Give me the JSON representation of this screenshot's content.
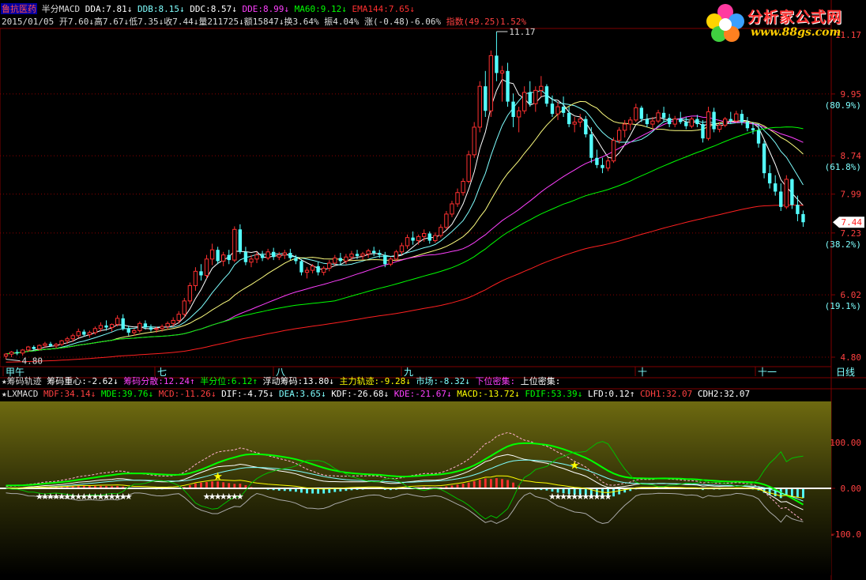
{
  "header": {
    "line1": [
      {
        "t": "鲁抗医药",
        "c": "#ff5050",
        "bg": "#0000a0"
      },
      {
        "t": " 半分MACD ",
        "c": "#dddddd"
      },
      {
        "t": "DDA:7.81↓",
        "c": "#ffffff"
      },
      {
        "t": " DDB:8.15↓",
        "c": "#7fffff"
      },
      {
        "t": " DDC:8.57↓",
        "c": "#ffffff"
      },
      {
        "t": " DDE:8.99↓",
        "c": "#ff40ff"
      },
      {
        "t": " MA60:9.12↓",
        "c": "#00ff00"
      },
      {
        "t": " EMA144:7.65↓",
        "c": "#ff3030"
      }
    ],
    "line2": [
      {
        "t": "2015/01/05 ",
        "c": "#dddddd"
      },
      {
        "t": "开7.60↓",
        "c": "#dddddd"
      },
      {
        "t": "高7.67↓",
        "c": "#dddddd"
      },
      {
        "t": "低7.35↓",
        "c": "#dddddd"
      },
      {
        "t": "收7.44↓",
        "c": "#dddddd"
      },
      {
        "t": "量211725↓",
        "c": "#dddddd"
      },
      {
        "t": "额15847↓",
        "c": "#dddddd"
      },
      {
        "t": "换3.64%",
        "c": "#dddddd"
      },
      {
        "t": " 振4.04%",
        "c": "#dddddd"
      },
      {
        "t": " 涨(-0.48)-6.06%",
        "c": "#dddddd"
      },
      {
        "t": " 指数(49.25)1.52%",
        "c": "#ff4040"
      }
    ]
  },
  "mid_header": [
    {
      "t": "★筹码轨迹 ",
      "c": "#dddddd"
    },
    {
      "t": "筹码重心:-2.62↓",
      "c": "#ffffff"
    },
    {
      "t": " 筹码分散:12.24↑",
      "c": "#ff40ff"
    },
    {
      "t": " 半分位:6.12↑",
      "c": "#00ff00"
    },
    {
      "t": " 浮动筹码:13.80↓",
      "c": "#ffffff"
    },
    {
      "t": " 主力轨迹:-9.28↓",
      "c": "#ffff00"
    },
    {
      "t": " 市场:-8.32↓",
      "c": "#7fffff"
    },
    {
      "t": " 下位密集:",
      "c": "#ff40ff"
    },
    {
      "t": " 上位密集:",
      "c": "#ffffff"
    }
  ],
  "lower_header": [
    {
      "t": "★LXMACD ",
      "c": "#dddddd"
    },
    {
      "t": "MDF:34.14↓",
      "c": "#ff4040"
    },
    {
      "t": " MDE:39.76↓",
      "c": "#00ff00"
    },
    {
      "t": " MCD:-11.26↓",
      "c": "#ff4040"
    },
    {
      "t": " DIF:-4.75↓",
      "c": "#ffffff"
    },
    {
      "t": " DEA:3.65↓",
      "c": "#7fffff"
    },
    {
      "t": " KDF:-26.68↓",
      "c": "#ffffff"
    },
    {
      "t": " KDE:-21.67↓",
      "c": "#ff40ff"
    },
    {
      "t": " MACD:-13.72↓",
      "c": "#ffff00"
    },
    {
      "t": " FDIF:53.39↓",
      "c": "#00ff00"
    },
    {
      "t": " LFD:0.12↑",
      "c": "#ffffff"
    },
    {
      "t": " CDH1:32.07",
      "c": "#ff4040"
    },
    {
      "t": " CDH2:32.07",
      "c": "#ffffff"
    }
  ],
  "price_axis": {
    "ticks": [
      {
        "v": "9.95",
        "pct": "(80.9%)"
      },
      {
        "v": "8.74",
        "pct": "(61.8%)"
      },
      {
        "v": "7.99",
        "pct": ""
      },
      {
        "v": "7.23",
        "pct": "(38.2%)"
      },
      {
        "v": "6.02",
        "pct": "(19.1%)"
      },
      {
        "v": "4.80",
        "pct": ""
      }
    ],
    "last_price": "7.44",
    "high_label": "11.17",
    "low_label": "4.80",
    "top_value": "11.17"
  },
  "macd_axis": [
    "100.00",
    "0.00",
    "-100.0"
  ],
  "months": [
    "甲午",
    "七",
    "八",
    "九",
    "十",
    "十一"
  ],
  "period_button": "日线",
  "chart_data": {
    "type": "candlestick",
    "date_last": "2015/01/05",
    "candles": [
      [
        4.82,
        4.88,
        4.76,
        4.86
      ],
      [
        4.86,
        4.92,
        4.8,
        4.9
      ],
      [
        4.9,
        4.95,
        4.84,
        4.88
      ],
      [
        4.88,
        4.96,
        4.83,
        4.94
      ],
      [
        4.94,
        5.02,
        4.9,
        5.0
      ],
      [
        5.0,
        5.03,
        4.92,
        4.96
      ],
      [
        4.96,
        5.05,
        4.93,
        5.03
      ],
      [
        5.03,
        5.1,
        4.98,
        5.06
      ],
      [
        5.06,
        5.1,
        5.0,
        5.02
      ],
      [
        5.02,
        5.08,
        4.97,
        5.05
      ],
      [
        5.05,
        5.14,
        5.02,
        5.12
      ],
      [
        5.12,
        5.2,
        5.06,
        5.16
      ],
      [
        5.16,
        5.26,
        5.1,
        5.22
      ],
      [
        5.22,
        5.36,
        5.18,
        5.3
      ],
      [
        5.3,
        5.34,
        5.2,
        5.24
      ],
      [
        5.24,
        5.32,
        5.18,
        5.28
      ],
      [
        5.28,
        5.4,
        5.24,
        5.36
      ],
      [
        5.36,
        5.48,
        5.3,
        5.42
      ],
      [
        5.42,
        5.52,
        5.32,
        5.38
      ],
      [
        5.38,
        5.46,
        5.3,
        5.44
      ],
      [
        5.44,
        5.62,
        5.4,
        5.56
      ],
      [
        5.56,
        5.64,
        5.32,
        5.36
      ],
      [
        5.36,
        5.42,
        5.22,
        5.28
      ],
      [
        5.28,
        5.36,
        5.22,
        5.32
      ],
      [
        5.32,
        5.5,
        5.28,
        5.46
      ],
      [
        5.46,
        5.52,
        5.34,
        5.38
      ],
      [
        5.38,
        5.44,
        5.3,
        5.34
      ],
      [
        5.34,
        5.4,
        5.28,
        5.36
      ],
      [
        5.36,
        5.44,
        5.3,
        5.4
      ],
      [
        5.4,
        5.5,
        5.34,
        5.46
      ],
      [
        5.46,
        5.58,
        5.4,
        5.52
      ],
      [
        5.52,
        5.7,
        5.46,
        5.64
      ],
      [
        5.64,
        5.96,
        5.58,
        5.9
      ],
      [
        5.9,
        6.26,
        5.84,
        6.2
      ],
      [
        6.2,
        6.56,
        6.1,
        6.48
      ],
      [
        6.48,
        6.62,
        6.3,
        6.4
      ],
      [
        6.4,
        6.8,
        6.34,
        6.72
      ],
      [
        6.72,
        7.02,
        6.6,
        6.9
      ],
      [
        6.9,
        6.96,
        6.62,
        6.68
      ],
      [
        6.68,
        6.86,
        6.58,
        6.8
      ],
      [
        6.8,
        6.9,
        6.62,
        6.7
      ],
      [
        6.7,
        7.36,
        6.66,
        7.3
      ],
      [
        7.3,
        7.4,
        6.82,
        6.86
      ],
      [
        6.86,
        6.96,
        6.6,
        6.66
      ],
      [
        6.66,
        6.8,
        6.56,
        6.72
      ],
      [
        6.72,
        6.86,
        6.64,
        6.8
      ],
      [
        6.8,
        6.88,
        6.68,
        6.74
      ],
      [
        6.74,
        6.92,
        6.7,
        6.86
      ],
      [
        6.86,
        6.94,
        6.7,
        6.76
      ],
      [
        6.76,
        6.86,
        6.7,
        6.8
      ],
      [
        6.8,
        6.9,
        6.72,
        6.84
      ],
      [
        6.84,
        6.92,
        6.7,
        6.74
      ],
      [
        6.74,
        6.8,
        6.62,
        6.68
      ],
      [
        6.68,
        6.72,
        6.4,
        6.46
      ],
      [
        6.46,
        6.56,
        6.34,
        6.5
      ],
      [
        6.5,
        6.62,
        6.44,
        6.58
      ],
      [
        6.58,
        6.66,
        6.4,
        6.46
      ],
      [
        6.46,
        6.58,
        6.4,
        6.54
      ],
      [
        6.54,
        6.7,
        6.48,
        6.64
      ],
      [
        6.64,
        6.8,
        6.6,
        6.74
      ],
      [
        6.74,
        6.84,
        6.62,
        6.68
      ],
      [
        6.68,
        6.82,
        6.62,
        6.76
      ],
      [
        6.76,
        6.88,
        6.7,
        6.82
      ],
      [
        6.82,
        6.9,
        6.72,
        6.78
      ],
      [
        6.78,
        6.86,
        6.7,
        6.82
      ],
      [
        6.82,
        6.92,
        6.74,
        6.88
      ],
      [
        6.88,
        6.96,
        6.78,
        6.84
      ],
      [
        6.84,
        6.9,
        6.74,
        6.8
      ],
      [
        6.8,
        6.86,
        6.56,
        6.62
      ],
      [
        6.62,
        6.76,
        6.58,
        6.72
      ],
      [
        6.72,
        6.9,
        6.68,
        6.86
      ],
      [
        6.86,
        7.04,
        6.8,
        6.98
      ],
      [
        6.98,
        7.2,
        6.92,
        7.14
      ],
      [
        7.14,
        7.26,
        7.0,
        7.08
      ],
      [
        7.08,
        7.2,
        7.0,
        7.16
      ],
      [
        7.16,
        7.3,
        7.06,
        7.22
      ],
      [
        7.22,
        7.26,
        7.02,
        7.08
      ],
      [
        7.08,
        7.24,
        7.04,
        7.18
      ],
      [
        7.18,
        7.4,
        7.14,
        7.34
      ],
      [
        7.34,
        7.66,
        7.3,
        7.6
      ],
      [
        7.6,
        7.86,
        7.54,
        7.8
      ],
      [
        7.8,
        8.1,
        7.74,
        8.02
      ],
      [
        8.02,
        8.3,
        7.96,
        8.24
      ],
      [
        8.24,
        8.84,
        8.2,
        8.76
      ],
      [
        8.76,
        9.4,
        8.7,
        9.3
      ],
      [
        9.3,
        10.2,
        9.2,
        10.1
      ],
      [
        10.1,
        10.4,
        9.5,
        9.62
      ],
      [
        9.62,
        10.8,
        9.5,
        10.7
      ],
      [
        10.7,
        11.17,
        10.2,
        10.36
      ],
      [
        10.36,
        10.5,
        9.8,
        10.4
      ],
      [
        10.4,
        10.56,
        9.7,
        9.8
      ],
      [
        9.8,
        9.96,
        9.3,
        9.5
      ],
      [
        9.5,
        9.7,
        9.2,
        9.62
      ],
      [
        9.62,
        10.1,
        9.56,
        9.98
      ],
      [
        9.98,
        10.2,
        9.7,
        9.76
      ],
      [
        9.76,
        10.1,
        9.6,
        10.02
      ],
      [
        10.02,
        10.3,
        9.9,
        10.1
      ],
      [
        10.1,
        10.14,
        9.7,
        9.76
      ],
      [
        9.76,
        9.92,
        9.5,
        9.56
      ],
      [
        9.56,
        9.8,
        9.44,
        9.7
      ],
      [
        9.7,
        9.9,
        9.5,
        9.58
      ],
      [
        9.58,
        9.7,
        9.3,
        9.36
      ],
      [
        9.36,
        9.5,
        9.2,
        9.4
      ],
      [
        9.4,
        9.56,
        9.3,
        9.46
      ],
      [
        9.46,
        9.52,
        9.1,
        9.16
      ],
      [
        9.16,
        9.3,
        8.6,
        8.7
      ],
      [
        8.7,
        8.86,
        8.5,
        8.56
      ],
      [
        8.56,
        8.7,
        8.4,
        8.5
      ],
      [
        8.5,
        8.7,
        8.44,
        8.64
      ],
      [
        8.64,
        9.1,
        8.6,
        9.04
      ],
      [
        9.04,
        9.3,
        8.98,
        9.24
      ],
      [
        9.24,
        9.44,
        9.1,
        9.36
      ],
      [
        9.36,
        9.5,
        9.24,
        9.44
      ],
      [
        9.44,
        9.76,
        9.4,
        9.68
      ],
      [
        9.68,
        9.72,
        9.4,
        9.46
      ],
      [
        9.46,
        9.56,
        9.3,
        9.36
      ],
      [
        9.36,
        9.5,
        9.28,
        9.42
      ],
      [
        9.42,
        9.64,
        9.38,
        9.58
      ],
      [
        9.58,
        9.7,
        9.4,
        9.48
      ],
      [
        9.48,
        9.56,
        9.3,
        9.36
      ],
      [
        9.36,
        9.52,
        9.3,
        9.46
      ],
      [
        9.46,
        9.6,
        9.36,
        9.4
      ],
      [
        9.4,
        9.5,
        9.26,
        9.32
      ],
      [
        9.32,
        9.5,
        9.28,
        9.46
      ],
      [
        9.46,
        9.54,
        9.3,
        9.36
      ],
      [
        9.36,
        9.44,
        9.0,
        9.08
      ],
      [
        9.08,
        9.7,
        9.04,
        9.6
      ],
      [
        9.6,
        9.68,
        9.2,
        9.26
      ],
      [
        9.26,
        9.4,
        9.2,
        9.34
      ],
      [
        9.34,
        9.5,
        9.3,
        9.46
      ],
      [
        9.46,
        9.6,
        9.36,
        9.42
      ],
      [
        9.42,
        9.62,
        9.38,
        9.56
      ],
      [
        9.56,
        9.64,
        9.34,
        9.4
      ],
      [
        9.4,
        9.5,
        9.22,
        9.28
      ],
      [
        9.28,
        9.4,
        9.16,
        9.24
      ],
      [
        9.24,
        9.36,
        8.9,
        8.98
      ],
      [
        8.98,
        9.04,
        8.3,
        8.4
      ],
      [
        8.4,
        8.56,
        8.1,
        8.2
      ],
      [
        8.2,
        8.36,
        7.96,
        8.04
      ],
      [
        8.04,
        8.2,
        7.66,
        7.74
      ],
      [
        7.74,
        8.36,
        7.7,
        8.28
      ],
      [
        8.28,
        8.3,
        7.7,
        7.78
      ],
      [
        7.78,
        7.96,
        7.46,
        7.6
      ],
      [
        7.6,
        7.67,
        7.35,
        7.44
      ]
    ],
    "ylim": [
      4.8,
      11.17
    ],
    "macd_ylim": [
      -190,
      190
    ]
  }
}
